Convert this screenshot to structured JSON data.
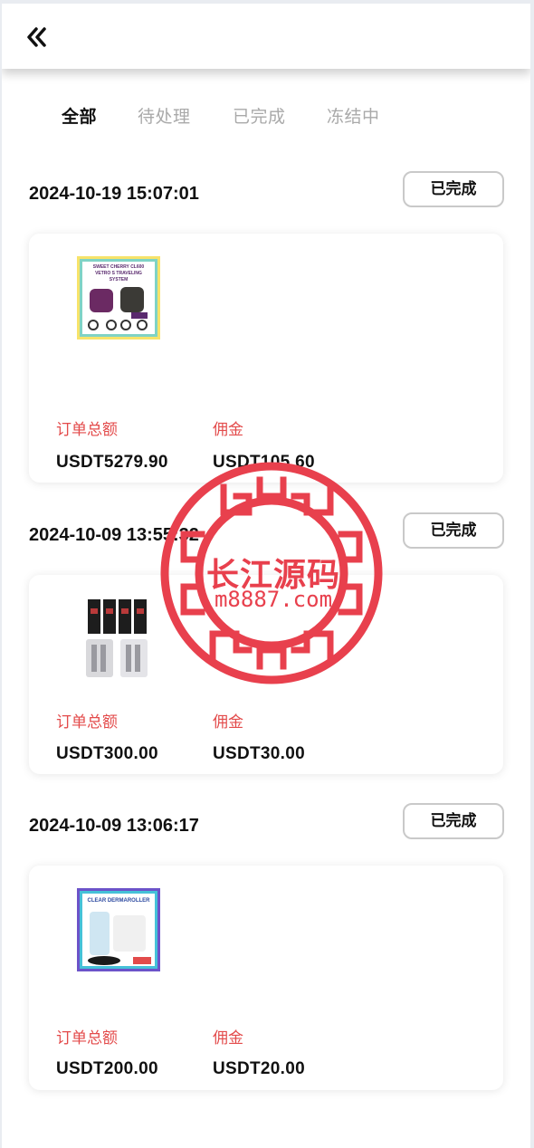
{
  "header": {
    "back_icon": "double-chevron-left-icon",
    "title": ""
  },
  "tabs": [
    {
      "label": "全部",
      "active": true
    },
    {
      "label": "待处理",
      "active": false
    },
    {
      "label": "已完成",
      "active": false
    },
    {
      "label": "冻结中",
      "active": false
    }
  ],
  "orders": [
    {
      "time": "2024-10-19 15:07:01",
      "status": "已完成",
      "image": "stroller-travel-system-image",
      "image_text": [
        "SWEET CHERRY CL600",
        "VETRO S TRAVELING",
        "SYSTEM"
      ],
      "total_label": "订单总额",
      "total_value": "USDT5279.90",
      "commission_label": "佣金",
      "commission_value": "USDT105.60"
    },
    {
      "time": "2024-10-09 13:55:32",
      "status": "已完成",
      "image": "vape-coils-image",
      "total_label": "订单总额",
      "total_value": "USDT300.00",
      "commission_label": "佣金",
      "commission_value": "USDT30.00"
    },
    {
      "time": "2024-10-09 13:06:17",
      "status": "已完成",
      "image": "dermaroller-image",
      "image_text": [
        "CLEAR DERMAROLLER"
      ],
      "total_label": "订单总额",
      "total_value": "USDT200.00",
      "commission_label": "佣金",
      "commission_value": "USDT20.00"
    }
  ],
  "watermark": {
    "name": "长江源码",
    "url": "m8887.com",
    "color": "#e8404d"
  },
  "colors": {
    "accent_red": "#e34b4b",
    "status_border": "#c9c9c9",
    "tab_inactive": "#a9a9a9"
  }
}
